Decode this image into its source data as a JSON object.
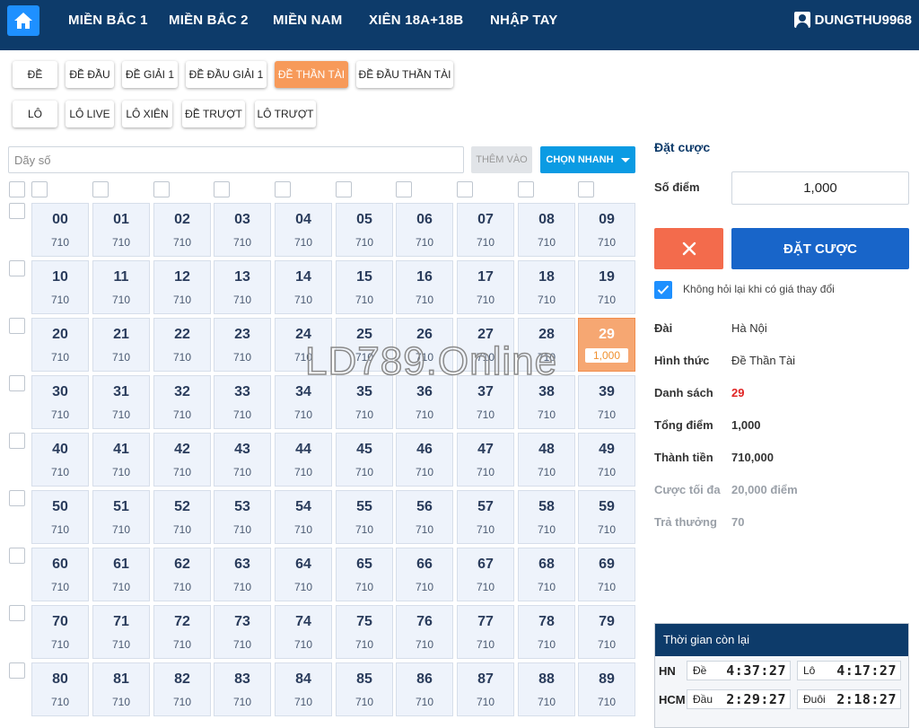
{
  "nav": {
    "items": [
      "MIỀN BẮC 1",
      "MIỀN BẮC 2",
      "MIỀN NAM",
      "XIÊN 18A+18B",
      "NHẬP TAY"
    ],
    "username": "DUNGTHU9968"
  },
  "bet_types": {
    "row1": [
      "ĐỀ",
      "ĐỀ ĐẦU",
      "ĐỀ GIẢI 1",
      "ĐỀ ĐẦU GIẢI 1",
      "ĐỀ THẦN TÀI",
      "ĐỀ ĐẦU THẦN TÀI"
    ],
    "row2": [
      "LÔ",
      "LÔ LIVE",
      "LÔ XIÊN",
      "ĐỀ TRƯỢT",
      "LÔ TRƯỢT"
    ],
    "active": "ĐỀ THẦN TÀI"
  },
  "number_input": {
    "placeholder": "Dãy số"
  },
  "add_label": "THÊM VÀO",
  "quick_label": "CHỌN NHANH",
  "grid": {
    "price": "710",
    "selected": "29",
    "selected_amount": "1,000",
    "numbers": [
      "00",
      "01",
      "02",
      "03",
      "04",
      "05",
      "06",
      "07",
      "08",
      "09",
      "10",
      "11",
      "12",
      "13",
      "14",
      "15",
      "16",
      "17",
      "18",
      "19",
      "20",
      "21",
      "22",
      "23",
      "24",
      "25",
      "26",
      "27",
      "28",
      "29",
      "30",
      "31",
      "32",
      "33",
      "34",
      "35",
      "36",
      "37",
      "38",
      "39",
      "40",
      "41",
      "42",
      "43",
      "44",
      "45",
      "46",
      "47",
      "48",
      "49",
      "50",
      "51",
      "52",
      "53",
      "54",
      "55",
      "56",
      "57",
      "58",
      "59",
      "60",
      "61",
      "62",
      "63",
      "64",
      "65",
      "66",
      "67",
      "68",
      "69",
      "70",
      "71",
      "72",
      "73",
      "74",
      "75",
      "76",
      "77",
      "78",
      "79",
      "80",
      "81",
      "82",
      "83",
      "84",
      "85",
      "86",
      "87",
      "88",
      "89"
    ]
  },
  "watermark": "LD789.Online",
  "bet_panel": {
    "title": "Đặt cược",
    "points_label": "Số điểm",
    "points_value": "1,000",
    "place_label": "ĐẶT CƯỢC",
    "no_ask_label": "Không hỏi lại khi có giá thay đổi",
    "dai_label": "Đài",
    "dai_value": "Hà Nội",
    "type_label": "Hình thức",
    "type_value": "Đề Thần Tài",
    "list_label": "Danh sách",
    "list_value": "29",
    "total_label": "Tổng điểm",
    "total_value": "1,000",
    "amount_label": "Thành tiền",
    "amount_value": "710,000",
    "max_label": "Cược tối đa",
    "max_value": "20,000 điểm",
    "payout_label": "Trả thưởng",
    "payout_value": "70"
  },
  "timer": {
    "title": "Thời gian còn lại",
    "rows": [
      {
        "region": "HN",
        "a_label": "Đề",
        "a_time": "4:37:27",
        "b_label": "Lô",
        "b_time": "4:17:27"
      },
      {
        "region": "HCM",
        "a_label": "Đầu",
        "a_time": "2:29:27",
        "b_label": "Đuôi",
        "b_time": "2:18:27"
      }
    ]
  },
  "colors": {
    "nav_bg": "#0d3b6a",
    "active_tab": "#f79a5a",
    "primary_button": "#1865c9",
    "cancel_button": "#f36b4c",
    "list_value": "#e02424"
  }
}
